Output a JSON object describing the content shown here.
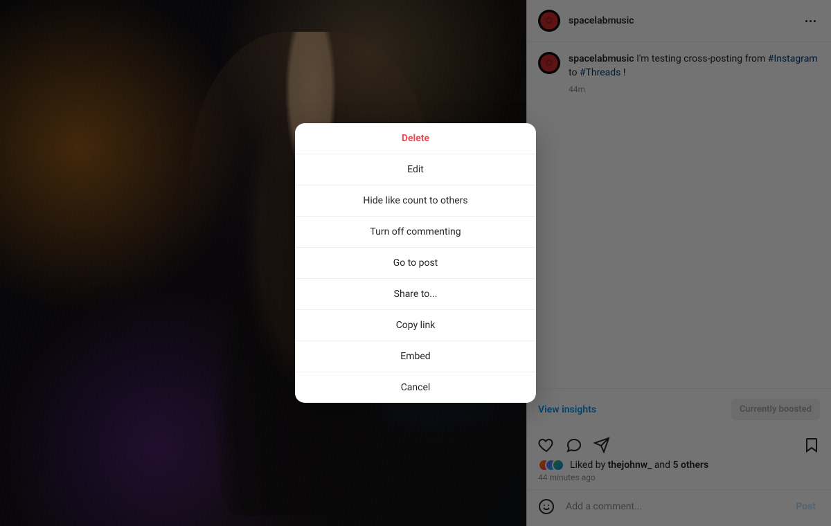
{
  "user": {
    "name": "spacelabmusic"
  },
  "caption": {
    "prefix": "I'm testing cross-posting from ",
    "tag1": "#Instagram",
    "mid": " to ",
    "tag2": "#Threads",
    "suffix": "!"
  },
  "times": {
    "short": "44m",
    "long": "44 minutes ago"
  },
  "insights": {
    "view": "View insights",
    "boosted": "Currently boosted"
  },
  "likes": {
    "lead": "Liked by ",
    "user": "thejohnw_",
    "join": " and ",
    "others": "5 others"
  },
  "comment": {
    "placeholder": "Add a comment...",
    "post": "Post"
  },
  "menu": {
    "delete": "Delete",
    "edit": "Edit",
    "hide": "Hide like count to others",
    "comments_off": "Turn off commenting",
    "goto": "Go to post",
    "share": "Share to...",
    "copy": "Copy link",
    "embed": "Embed",
    "cancel": "Cancel"
  }
}
